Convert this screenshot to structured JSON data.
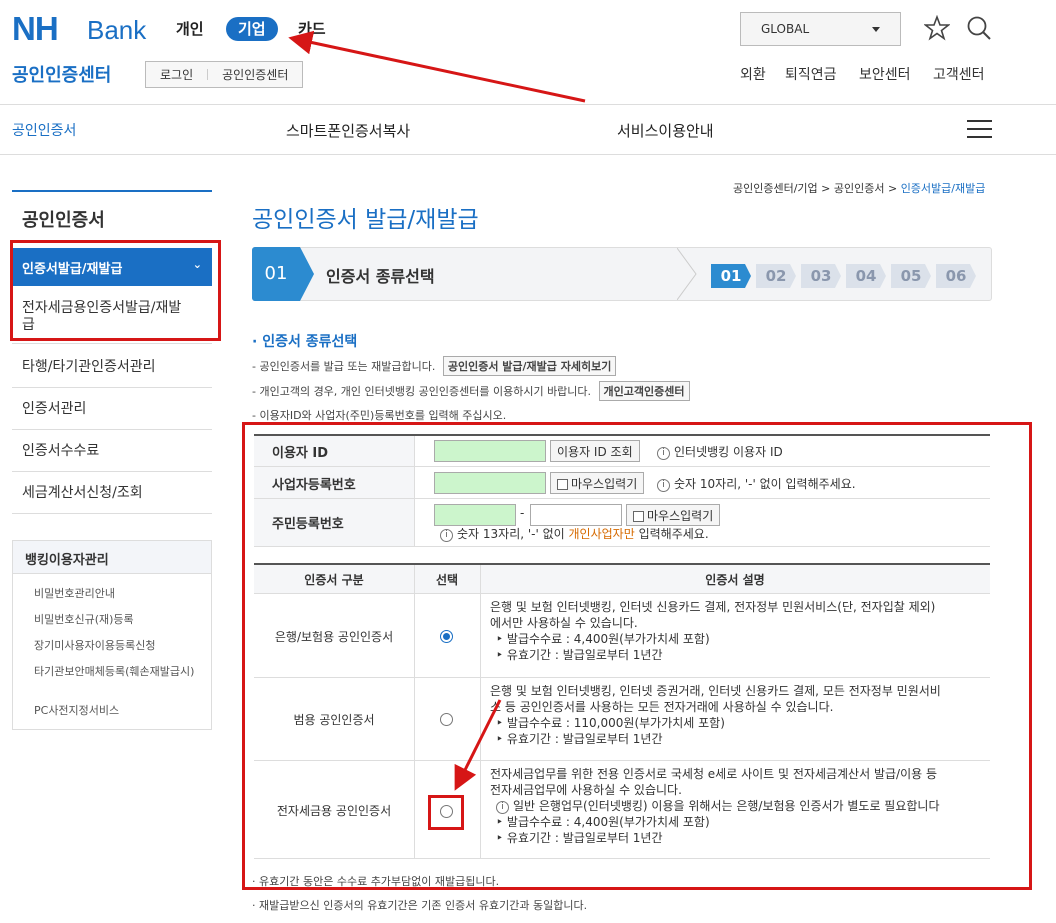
{
  "header": {
    "logo_nh": "NH",
    "logo_bank": "Bank",
    "nav": [
      "개인",
      "기업",
      "카드"
    ],
    "site_title": "공인인증센터",
    "buttons": [
      "로그인",
      "공인인증센터"
    ],
    "global_select": "GLOBAL",
    "util_links": [
      "외환",
      "퇴직연금",
      "보안센터",
      "고객센터"
    ],
    "icons": [
      "star-icon",
      "search-icon",
      "menu-icon"
    ]
  },
  "gnb": {
    "current": "공인인증서",
    "items": [
      "스마트폰인증서복사",
      "서비스이용안내"
    ]
  },
  "lnb": {
    "title": "공인인증서",
    "items": [
      "인증서발급/재발급",
      "전자세금용인증서발급/재발급",
      "타행/타기관인증서관리",
      "인증서관리",
      "인증서수수료",
      "세금계산서신청/조회"
    ],
    "sub_title": "뱅킹이용자관리",
    "sub_items": [
      "비밀번호관리안내",
      "비밀번호신규(재)등록",
      "장기미사용자이용등록신청",
      "타기관보안매체등록(훼손재발급시)",
      "PC사전지정서비스"
    ]
  },
  "breadcrumb": {
    "path": "공인인증센터/기업 > 공인인증서 > ",
    "current": "인증서발급/재발급"
  },
  "page_title": "공인인증서 발급/재발급",
  "steps": {
    "current_num": "01",
    "current_label": "인증서 종류선택",
    "nums": [
      "01",
      "02",
      "03",
      "04",
      "05",
      "06"
    ],
    "active_index": 0
  },
  "intro": {
    "heading": "인증서 종류선택",
    "line1": "공인인증서를 발급 또는 재발급합니다.",
    "line1_btn": "공인인증서 발급/재발급 자세히보기",
    "line2": "개인고객의 경우, 개인 인터넷뱅킹 공인인증센터를 이용하시기 바랍니다.",
    "line2_btn": "개인고객인증센터",
    "line3": "이용자ID와 사업자(주민)등록번호를 입력해 주십시오."
  },
  "form": {
    "user_id_label": "이용자 ID",
    "user_id_btn": "이용자 ID 조회",
    "user_id_note": "인터넷뱅킹 이용자 ID",
    "biz_label": "사업자등록번호",
    "mouse_input": "마우스입력기",
    "biz_note": "숫자 10자리, '-' 없이 입력해주세요.",
    "rrn_label": "주민등록번호",
    "rrn_dash": "-",
    "rrn_note_a": "숫자 13자리, '-' 없이 ",
    "rrn_note_highlight": "개인사업자만",
    "rrn_note_b": " 입력해주세요."
  },
  "cert_table": {
    "headers": [
      "인증서 구분",
      "선택",
      "인증서 설명"
    ],
    "rows": [
      {
        "name": "은행/보험용 공인인증서",
        "selected": true,
        "desc": [
          "은행 및 보험 인터넷뱅킹, 인터넷 신용카드 결제, 전자정부 민원서비스(단, 전자입찰 제외)",
          "에서만 사용하실 수 있습니다."
        ],
        "fee": "발급수수료 : 4,400원(부가가치세 포함)",
        "period": "유효기간 : 발급일로부터 1년간"
      },
      {
        "name": "범용 공인인증서",
        "selected": false,
        "desc": [
          "은행 및 보험 인터넷뱅킹, 인터넷 증권거래, 인터넷 신용카드 결제, 모든 전자정부 민원서비",
          "스 등 공인인증서를 사용하는 모든 전자거래에 사용하실 수 있습니다."
        ],
        "fee": "발급수수료 : 110,000원(부가가치세 포함)",
        "period": "유효기간 : 발급일로부터 1년간"
      },
      {
        "name": "전자세금용 공인인증서",
        "selected": false,
        "desc": [
          "전자세금업무를 위한 전용 인증서로 국세청 e세로 사이트 및 전자세금계산서 발급/이용 등",
          "전자세금업무에 사용하실 수 있습니다."
        ],
        "notice": "일반 은행업무(인터넷뱅킹) 이용을 위해서는 은행/보험용 인증서가 별도로 필요합니다",
        "fee": "발급수수료 : 4,400원(부가가치세 포함)",
        "period": "유효기간 : 발급일로부터 1년간"
      }
    ]
  },
  "footnotes": [
    "유효기간 동안은 수수료 추가부담없이 재발급됩니다.",
    "재발급받으신 인증서의 유효기간은 기존 인증서 유효기간과 동일합니다."
  ],
  "colors": {
    "brand": "#1a6fc4",
    "annotation": "#d61616",
    "input_bg": "#ccf5cc"
  }
}
